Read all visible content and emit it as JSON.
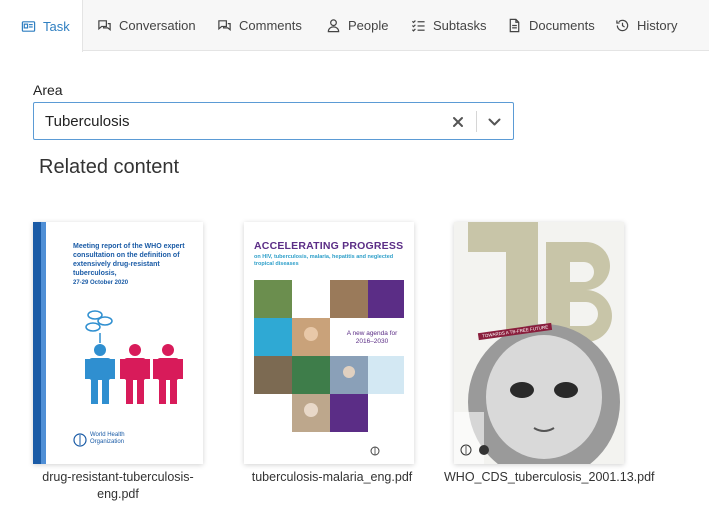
{
  "tabs": [
    {
      "label": "Task",
      "icon": "id-card-icon",
      "active": true
    },
    {
      "label": "Conversation",
      "icon": "chat-bubbles-icon",
      "active": false
    },
    {
      "label": "Comments",
      "icon": "comment-bubbles-icon",
      "active": false
    },
    {
      "label": "People",
      "icon": "person-icon",
      "active": false
    },
    {
      "label": "Subtasks",
      "icon": "checklist-icon",
      "active": false
    },
    {
      "label": "Documents",
      "icon": "document-icon",
      "active": false
    },
    {
      "label": "History",
      "icon": "history-icon",
      "active": false
    }
  ],
  "area": {
    "label": "Area",
    "value": "Tuberculosis"
  },
  "related": {
    "title": "Related content",
    "items": [
      {
        "filename": "drug-resistant-tuberculosis-eng.pdf",
        "cover_title": "Meeting report of the WHO expert consultation on the definition of extensively drug-resistant tuberculosis,",
        "cover_date": "27-29 October 2020",
        "cover_publisher": "World Health Organization"
      },
      {
        "filename": "tuberculosis-malaria_eng.pdf",
        "cover_title": "ACCELERATING PROGRESS",
        "cover_subtitle": "on HIV, tuberculosis, malaria, hepatitis and neglected tropical diseases",
        "cover_agenda": "A new agenda for 2016–2030"
      },
      {
        "filename": "WHO_CDS_tuberculosis_2001.13.pdf",
        "cover_title": "TB",
        "cover_banner": "TOWARDS A TB-FREE FUTURE"
      }
    ]
  },
  "colors": {
    "accent": "#2f7fc1",
    "who_blue": "#1a5ba6",
    "figure_red": "#d81b5a",
    "figure_blue": "#2f8fd0",
    "accel_purple": "#5b2d86"
  }
}
